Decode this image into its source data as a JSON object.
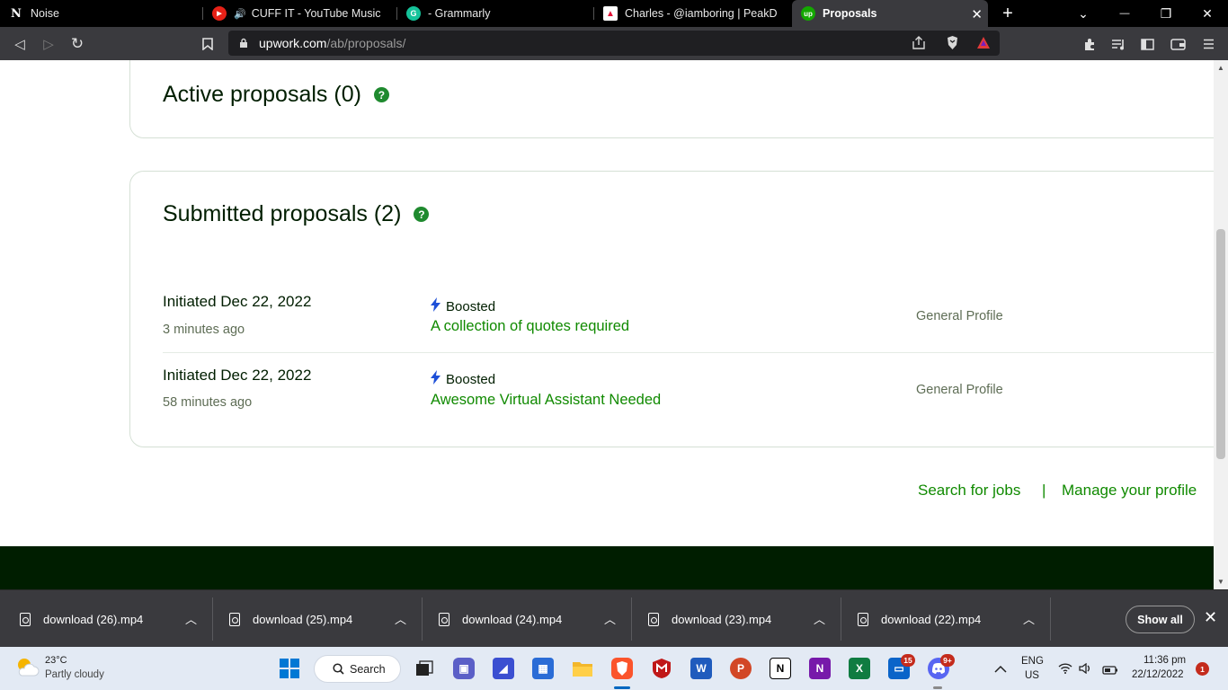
{
  "tabs": [
    {
      "label": "Noise",
      "favicon": "N",
      "icon": "notion-icon"
    },
    {
      "label": "CUFF IT - YouTube Music",
      "favicon": "▶",
      "icon": "youtube-music-icon"
    },
    {
      "label": "- Grammarly",
      "favicon": "G",
      "icon": "grammarly-icon"
    },
    {
      "label": "Charles - @iamboring | PeakD",
      "favicon": "▲",
      "icon": "peakd-icon"
    },
    {
      "label": "Proposals",
      "favicon": "up",
      "icon": "upwork-icon",
      "active": true
    }
  ],
  "tab_close": "✕",
  "new_tab": "+",
  "window_controls": {
    "tab_search": "⌄",
    "minimize": "—",
    "restore": "❐",
    "close": "✕"
  },
  "nav": {
    "back": "◁",
    "forward": "▷",
    "reload": "↻",
    "bookmark": "🔖"
  },
  "url": {
    "host": "upwork.com",
    "path": "/ab/proposals/"
  },
  "page": {
    "active_title": "Active proposals (0)",
    "submitted_title": "Submitted proposals (2)",
    "help": "?",
    "proposals": [
      {
        "date": "Initiated Dec 22, 2022",
        "ago": "3 minutes ago",
        "badge": "Boosted",
        "title": "A collection of quotes required",
        "profile": "General Profile"
      },
      {
        "date": "Initiated Dec 22, 2022",
        "ago": "58 minutes ago",
        "badge": "Boosted",
        "title": "Awesome Virtual Assistant Needed",
        "profile": "General Profile"
      }
    ],
    "footer_links": {
      "search": "Search for jobs",
      "sep": "|",
      "manage": "Manage your profile"
    }
  },
  "downloads": [
    {
      "name": "download (26).mp4"
    },
    {
      "name": "download (25).mp4"
    },
    {
      "name": "download (24).mp4"
    },
    {
      "name": "download (23).mp4"
    },
    {
      "name": "download (22).mp4"
    }
  ],
  "downloads_show_all": "Show all",
  "downloads_close": "✕",
  "taskbar": {
    "weather_temp": "23°C",
    "weather_desc": "Partly cloudy",
    "search_label": "Search",
    "language": "ENG",
    "region": "US",
    "time": "11:36 pm",
    "date": "22/12/2022",
    "notification_count": "1",
    "badge_outlook": "15",
    "badge_discord": "9+"
  },
  "colors": {
    "accent": "#108a00",
    "title": "#001e00",
    "tab_bar": "#000000",
    "toolbar": "#3a3a3e"
  }
}
